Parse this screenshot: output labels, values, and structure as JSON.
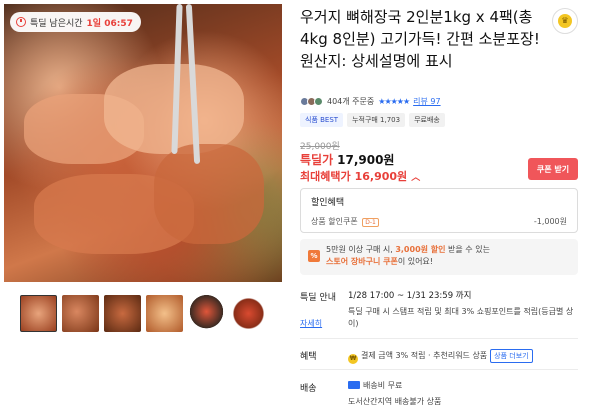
{
  "product": {
    "timer": {
      "label": "특딜 남은시간",
      "time": "1일 06:57"
    },
    "title": "우거지 뼈해장국 2인분1kg x 4팩(총 4kg 8인분) 고기가득! 간편 소분포장! 원산지: 상세설명에 표시",
    "review": {
      "buyers": "404개 주문중",
      "stars": "★★★★★",
      "review_link": "리뷰 97"
    },
    "tags": [
      "식품 BEST",
      "누적구매 1,703",
      "무료배송"
    ],
    "price": {
      "original": "25,000원",
      "deal_label": "특딜가",
      "deal_price": "17,900원",
      "max_label": "최대혜택가",
      "max_price": "16,900원",
      "coupon_button": "쿠폰 받기"
    },
    "discount": {
      "heading": "할인혜택",
      "item_label": "상품 할인쿠폰",
      "item_tag": "D-1",
      "item_value": "-1,000원"
    },
    "promo": {
      "line1_pre": "5만원 이상 구매 시, ",
      "line1_hl": "3,000원 할인",
      "line1_post": " 받을 수 있는",
      "line2_hl": "스토어 장바구니 쿠폰",
      "line2_post": "이 있어요!"
    },
    "deal_info": {
      "label": "특딜 안내",
      "period": "1/28 17:00 ~ 1/31 23:59 까지",
      "desc": "특딜 구매 시 스탬프 적립 및 최대 3% 쇼핑포인트를 적립(등급별 상이)",
      "link": "자세히"
    },
    "benefit": {
      "label": "혜택",
      "text": "결제 금액 3% 적립 · 추천리워드 상품",
      "more": "상품 더보기"
    },
    "shipping": {
      "label": "배송",
      "fee": "배송비 무료",
      "note": "도서산간지역 배송불가 상품"
    }
  }
}
